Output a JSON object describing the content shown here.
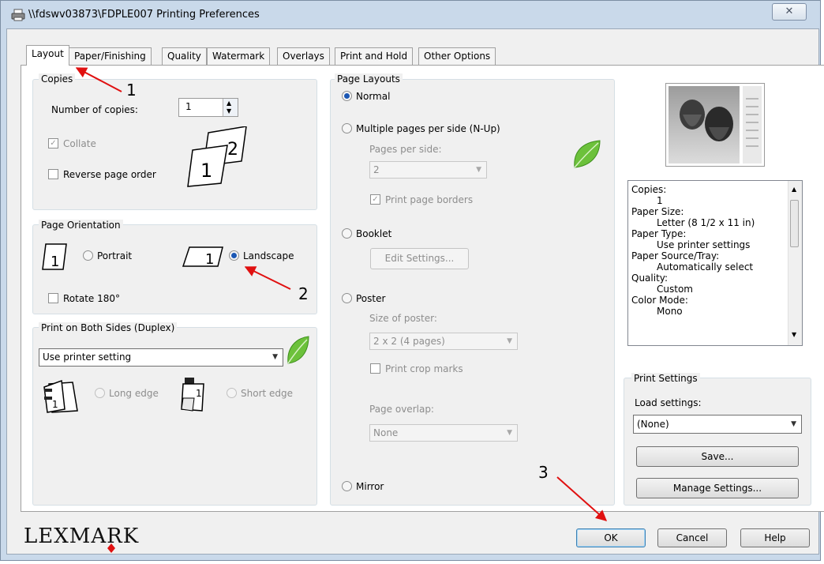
{
  "window": {
    "title": "\\\\fdswv03873\\FDPLE007 Printing Preferences",
    "close_label": "✕"
  },
  "tabs": [
    "Layout",
    "Paper/Finishing",
    "Quality",
    "Watermark",
    "Overlays",
    "Print and Hold",
    "Other Options"
  ],
  "copies": {
    "group_label": "Copies",
    "number_label": "Number of copies:",
    "number_value": "1",
    "collate_label": "Collate",
    "reverse_label": "Reverse page order"
  },
  "orientation": {
    "group_label": "Page Orientation",
    "portrait_label": "Portrait",
    "landscape_label": "Landscape",
    "rotate_label": "Rotate 180°"
  },
  "duplex": {
    "group_label": "Print on Both Sides (Duplex)",
    "selected": "Use printer setting",
    "long_edge_label": "Long edge",
    "short_edge_label": "Short edge"
  },
  "page_layouts": {
    "group_label": "Page Layouts",
    "normal_label": "Normal",
    "nup_label": "Multiple pages per side (N-Up)",
    "pages_per_side_label": "Pages per side:",
    "pages_per_side_value": "2",
    "print_borders_label": "Print page borders",
    "booklet_label": "Booklet",
    "edit_settings_label": "Edit Settings...",
    "poster_label": "Poster",
    "size_of_poster_label": "Size of poster:",
    "size_of_poster_value": "2 x 2 (4 pages)",
    "print_crop_label": "Print crop marks",
    "page_overlap_label": "Page overlap:",
    "page_overlap_value": "None",
    "mirror_label": "Mirror"
  },
  "summary": [
    {
      "text": "Copies:",
      "indent": false
    },
    {
      "text": "1",
      "indent": true
    },
    {
      "text": "Paper Size:",
      "indent": false
    },
    {
      "text": "Letter (8 1/2 x 11 in)",
      "indent": true
    },
    {
      "text": "Paper Type:",
      "indent": false
    },
    {
      "text": "Use printer settings",
      "indent": true
    },
    {
      "text": "Paper Source/Tray:",
      "indent": false
    },
    {
      "text": "Automatically select",
      "indent": true
    },
    {
      "text": "Quality:",
      "indent": false
    },
    {
      "text": "Custom",
      "indent": true
    },
    {
      "text": "Color Mode:",
      "indent": false
    },
    {
      "text": "Mono",
      "indent": true
    }
  ],
  "print_settings": {
    "group_label": "Print Settings",
    "load_label": "Load settings:",
    "load_value": "(None)",
    "save_label": "Save...",
    "manage_label": "Manage Settings..."
  },
  "footer": {
    "logo": "LEXMARK",
    "ok_label": "OK",
    "cancel_label": "Cancel",
    "help_label": "Help"
  },
  "annotations": [
    "1",
    "2",
    "3"
  ],
  "colors": {
    "accent": "#1b57b4",
    "annotation": "#e01010",
    "title_bar": "#c9d9ea",
    "leaf_green": "#58b230"
  }
}
